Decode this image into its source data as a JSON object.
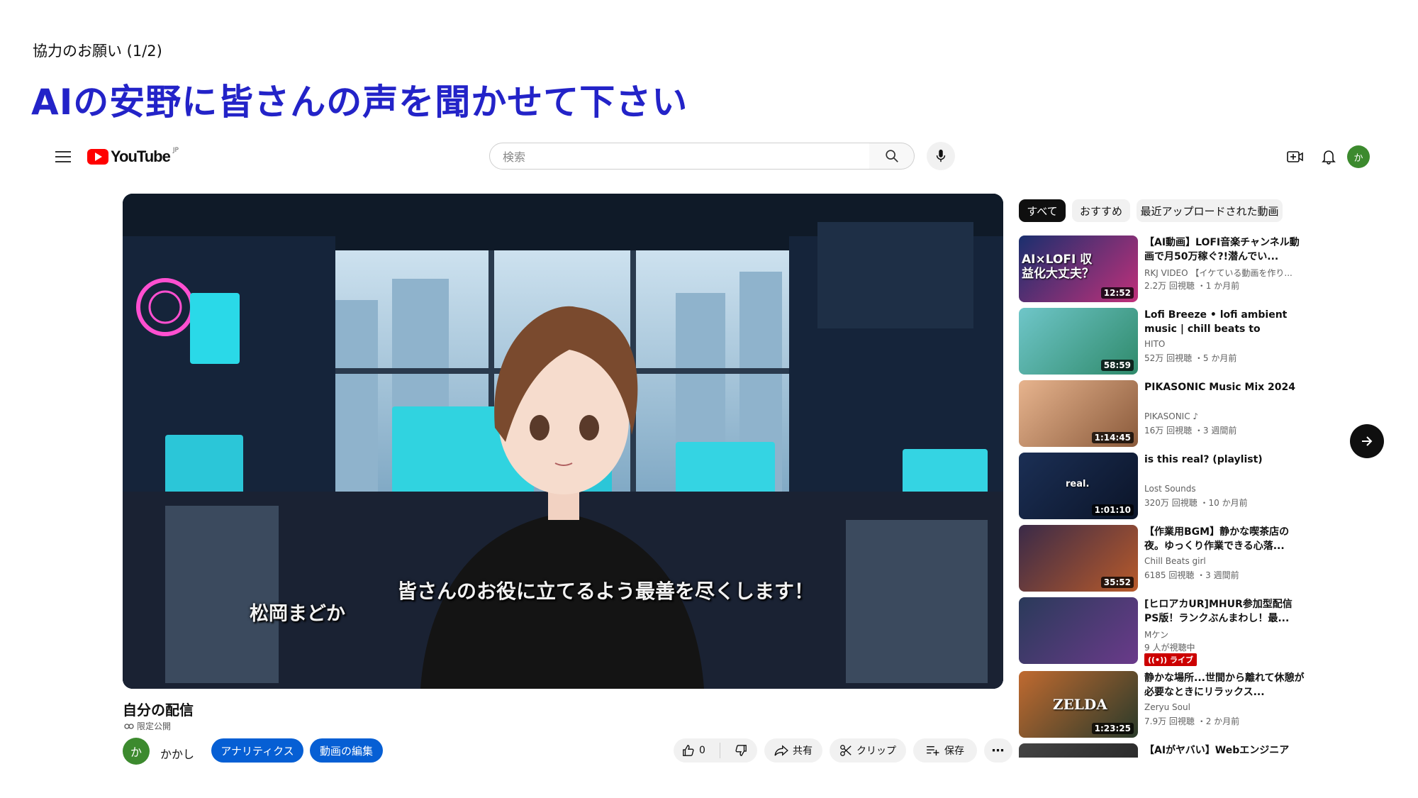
{
  "slide": {
    "subtitle": "協力のお願い (1/2)",
    "title": "AIの安野に皆さんの声を聞かせて下さい"
  },
  "header": {
    "logo_text": "YouTube",
    "region": "JP",
    "search_placeholder": "検索",
    "avatar_char": "か"
  },
  "player": {
    "caption": "皆さんのお役に立てるよう最善を尽くします！",
    "speaker_name": "松岡まどか"
  },
  "video": {
    "title": "自分の配信",
    "privacy": "限定公開",
    "channel_avatar_char": "か",
    "channel_name": "かかし",
    "analytics_label": "アナリティクス",
    "edit_label": "動画の編集",
    "like_count": "0",
    "share_label": "共有",
    "clip_label": "クリップ",
    "save_label": "保存"
  },
  "chips": [
    "すべて",
    "おすすめ",
    "最近アップロードされた動画"
  ],
  "recommendations": [
    {
      "title": "【AI動画】LOFI音楽チャンネル動画で月50万稼ぐ?!潜んでい...",
      "channel": "RKJ VIDEO 【イケている動画を作り...",
      "meta": "2.2万 回視聴 ・1 か月前",
      "duration": "12:52",
      "thumb_text": "AI×LOFI 収益化大丈夫？",
      "bg1": "#1a2f6e",
      "bg2": "#c0307a"
    },
    {
      "title": "Lofi Breeze • lofi ambient music | chill beats to relax/study to",
      "channel": "HITO",
      "meta": "52万 回視聴 ・5 か月前",
      "duration": "58:59",
      "thumb_text": "",
      "bg1": "#6fc6c9",
      "bg2": "#2f8a6b"
    },
    {
      "title": "PIKASONIC Music Mix 2024",
      "channel": "PIKASONIC ♪",
      "meta": "16万 回視聴 ・3 週間前",
      "duration": "1:14:45",
      "thumb_text": "",
      "bg1": "#e7b48e",
      "bg2": "#8a5a3b"
    },
    {
      "title": "is this real? (playlist)",
      "channel": "Lost Sounds",
      "meta": "320万 回視聴 ・10 か月前",
      "duration": "1:01:10",
      "thumb_text": "real.",
      "bg1": "#1b2f55",
      "bg2": "#0b1428"
    },
    {
      "title": "【作業用BGM】静かな喫茶店の夜。ゆっくり作業できる心落...",
      "channel": "Chill Beats girl",
      "meta": "6185 回視聴 ・3 週間前",
      "duration": "35:52",
      "thumb_text": "",
      "bg1": "#3a2a48",
      "bg2": "#b85a2a"
    },
    {
      "title": "[ヒロアカUR]MHUR参加型配信 PS版！ランクぶんまわし！最...",
      "channel": "Mケン",
      "meta": "9 人が視聴中",
      "duration": "",
      "live": "((•)) ライブ",
      "thumb_text": "",
      "bg1": "#2a3a5a",
      "bg2": "#6a3a8a"
    },
    {
      "title": "静かな場所...世間から離れて休憩が必要なときにリラックス...",
      "channel": "Zeryu Soul",
      "meta": "7.9万 回視聴 ・2 か月前",
      "duration": "1:23:25",
      "thumb_text": "ZELDA",
      "bg1": "#c06a30",
      "bg2": "#2a3a2a"
    },
    {
      "title": "【AIがヤバい】Webエンジニア",
      "channel": "",
      "meta": "",
      "duration": "",
      "thumb_text": "",
      "bg1": "#444444",
      "bg2": "#222222"
    }
  ]
}
